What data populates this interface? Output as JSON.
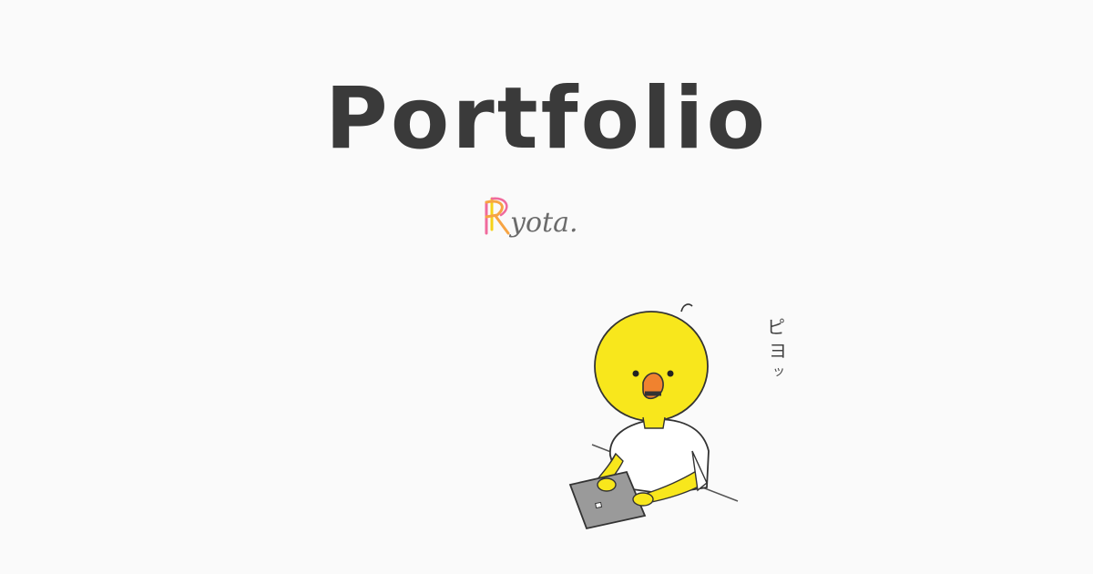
{
  "header": {
    "title": "Portfolio"
  },
  "logo": {
    "text": "yota.",
    "monogram_letter": "R",
    "colors": {
      "pink": "#f06a9c",
      "orange": "#f7a443",
      "yellow": "#f5d21a"
    }
  },
  "illustration": {
    "character": "yellow-chick-at-laptop",
    "sound_effect": [
      "ピ",
      "ヨ",
      "ッ"
    ],
    "colors": {
      "body": "#f8e71c",
      "beak": "#f0822f",
      "shirt": "#ffffff",
      "laptop": "#9a9a9a",
      "outline": "#333333"
    }
  }
}
